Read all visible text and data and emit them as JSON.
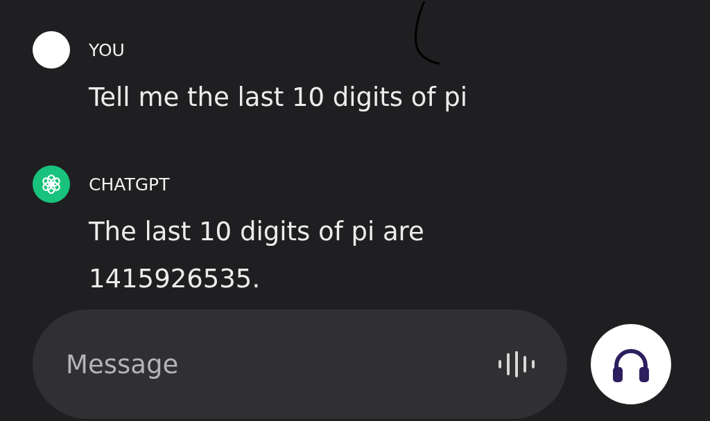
{
  "messages": [
    {
      "author": "YOU",
      "kind": "user",
      "text": "Tell me the last 10 digits of pi"
    },
    {
      "author": "CHATGPT",
      "kind": "assistant",
      "text": "The last 10 digits of pi are 1415926535."
    }
  ],
  "composer": {
    "placeholder": "Message"
  }
}
